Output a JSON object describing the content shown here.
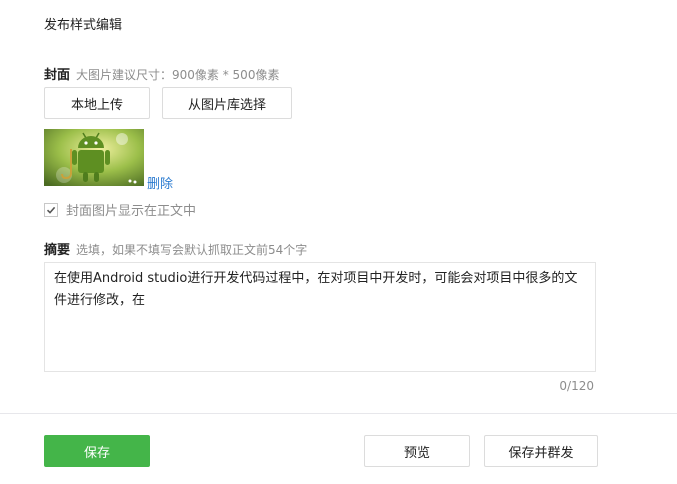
{
  "page": {
    "title": "发布样式编辑"
  },
  "cover": {
    "label": "封面",
    "hint": "大图片建议尺寸：900像素 * 500像素",
    "upload_local_label": "本地上传",
    "choose_library_label": "从图片库选择",
    "delete_label": "删除",
    "show_in_body_label": "封面图片显示在正文中",
    "show_in_body_checked": true
  },
  "summary": {
    "label": "摘要",
    "hint": "选填，如果不填写会默认抓取正文前54个字",
    "value": "在使用Android studio进行开发代码过程中，在对项目中开发时，可能会对项目中很多的文件进行修改，在",
    "counter": "0/120"
  },
  "footer": {
    "save_label": "保存",
    "preview_label": "预览",
    "save_and_publish_label": "保存并群发"
  },
  "colors": {
    "accent_green": "#44b549",
    "link_blue": "#2b7bd0"
  }
}
